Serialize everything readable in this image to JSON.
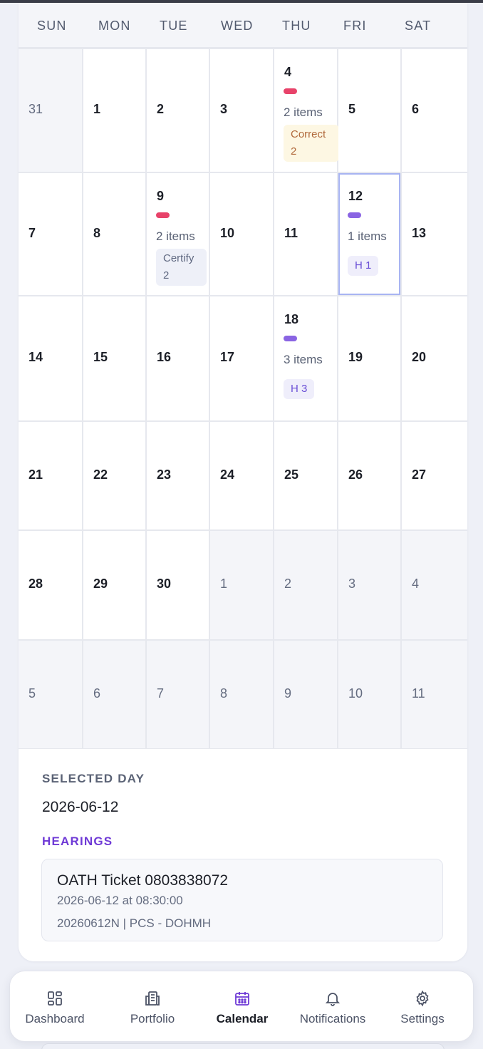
{
  "weekdays": [
    "SUN",
    "MON",
    "TUE",
    "WED",
    "THU",
    "FRI",
    "SAT"
  ],
  "weeks": [
    [
      {
        "day": "31",
        "muted": true
      },
      {
        "day": "1"
      },
      {
        "day": "2"
      },
      {
        "day": "3"
      },
      {
        "day": "4",
        "pill_color": "#e8436a",
        "items": "2 items",
        "tag": "Correct 2",
        "tag_style": "correct"
      },
      {
        "day": "5"
      },
      {
        "day": "6"
      }
    ],
    [
      {
        "day": "7"
      },
      {
        "day": "8"
      },
      {
        "day": "9",
        "pill_color": "#e8436a",
        "items": "2 items",
        "tag": "Certify 2",
        "tag_style": "certify"
      },
      {
        "day": "10"
      },
      {
        "day": "11"
      },
      {
        "day": "12",
        "pill_color": "#8a64e3",
        "items": "1 items",
        "tag": "H 1",
        "tag_style": "h",
        "selected": true
      },
      {
        "day": "13"
      }
    ],
    [
      {
        "day": "14"
      },
      {
        "day": "15"
      },
      {
        "day": "16"
      },
      {
        "day": "17"
      },
      {
        "day": "18",
        "pill_color": "#8a64e3",
        "items": "3 items",
        "tag": "H 3",
        "tag_style": "h"
      },
      {
        "day": "19"
      },
      {
        "day": "20"
      }
    ],
    [
      {
        "day": "21"
      },
      {
        "day": "22"
      },
      {
        "day": "23"
      },
      {
        "day": "24"
      },
      {
        "day": "25"
      },
      {
        "day": "26"
      },
      {
        "day": "27"
      }
    ],
    [
      {
        "day": "28"
      },
      {
        "day": "29"
      },
      {
        "day": "30"
      },
      {
        "day": "1",
        "muted": true
      },
      {
        "day": "2",
        "muted": true
      },
      {
        "day": "3",
        "muted": true
      },
      {
        "day": "4",
        "muted": true
      }
    ],
    [
      {
        "day": "5",
        "muted": true
      },
      {
        "day": "6",
        "muted": true
      },
      {
        "day": "7",
        "muted": true
      },
      {
        "day": "8",
        "muted": true
      },
      {
        "day": "9",
        "muted": true
      },
      {
        "day": "10",
        "muted": true
      },
      {
        "day": "11",
        "muted": true
      }
    ]
  ],
  "selected_day": {
    "label": "SELECTED DAY",
    "date": "2026-06-12",
    "section_label": "HEARINGS",
    "hearing": {
      "title": "OATH Ticket 0803838072",
      "when": "2026-06-12 at 08:30:00",
      "meta": "20260612N | PCS - DOHMH"
    }
  },
  "nav": [
    {
      "label": "Dashboard",
      "icon": "dashboard-icon"
    },
    {
      "label": "Portfolio",
      "icon": "portfolio-icon"
    },
    {
      "label": "Calendar",
      "icon": "calendar-icon",
      "active": true
    },
    {
      "label": "Notifications",
      "icon": "bell-icon"
    },
    {
      "label": "Settings",
      "icon": "gear-icon"
    }
  ],
  "colors": {
    "accent": "#6f3ad6",
    "selected_outline": "#a8b4f2",
    "pill_red": "#e8436a",
    "pill_purple": "#8a64e3"
  }
}
